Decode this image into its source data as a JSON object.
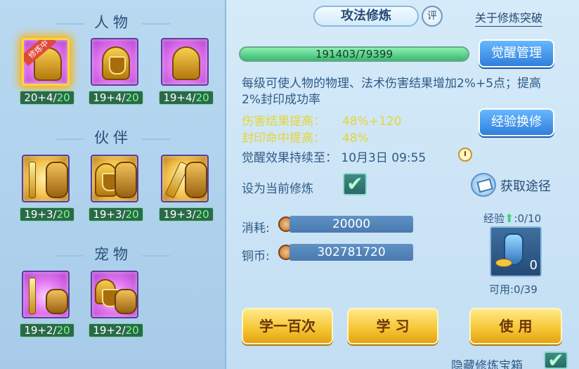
{
  "sections": {
    "character_title": "人物",
    "partner_title": "伙伴",
    "pet_title": "宠物"
  },
  "character_slots": [
    {
      "level_prefix": "20+4/",
      "level_max": "20",
      "badge": "修炼中"
    },
    {
      "level_prefix": "19+4/",
      "level_max": "20"
    },
    {
      "level_prefix": "19+4/",
      "level_max": "20"
    }
  ],
  "partner_slots": [
    {
      "level_prefix": "19+3/",
      "level_max": "20"
    },
    {
      "level_prefix": "19+3/",
      "level_max": "20"
    },
    {
      "level_prefix": "19+3/",
      "level_max": "20"
    }
  ],
  "pet_slots": [
    {
      "level_prefix": "19+2/",
      "level_max": "20"
    },
    {
      "level_prefix": "19+2/",
      "level_max": "20"
    }
  ],
  "header": {
    "title": "攻法修炼",
    "eval_label": "评",
    "about_link": "关于修炼突破"
  },
  "progress": {
    "text": "191403/79399",
    "fill_fraction": 1.0
  },
  "buttons": {
    "awaken_manage": "觉醒管理",
    "exp_exchange": "经验换修",
    "learn_hundred": "学一百次",
    "learn": "学 习",
    "use": "使 用"
  },
  "description": "每级可使人物的物理、法术伤害结果增加2%+5点；提高2%封印成功率",
  "stats": [
    {
      "key": "伤害结果提高：",
      "value": "48%+120"
    },
    {
      "key": "封印命中提高：",
      "value": "48%"
    }
  ],
  "persist": "觉醒效果持续至：  10月3日 09:55",
  "set_current": {
    "label": "设为当前修炼",
    "checked": true,
    "check_glyph": "✔"
  },
  "obtain": {
    "label": "获取途径"
  },
  "cost": {
    "consume_label": "消耗:",
    "consume_value": "20000",
    "coins_label": "铜币:",
    "coins_value": "302781720"
  },
  "item": {
    "exp_label": "经验",
    "exp_arrow": "⬆",
    "exp_value": ":0/10",
    "count": "0",
    "available": "可用:0/39"
  },
  "hide_chest": {
    "label": "隐藏修炼宝箱",
    "checked": true,
    "check_glyph": "✔"
  }
}
